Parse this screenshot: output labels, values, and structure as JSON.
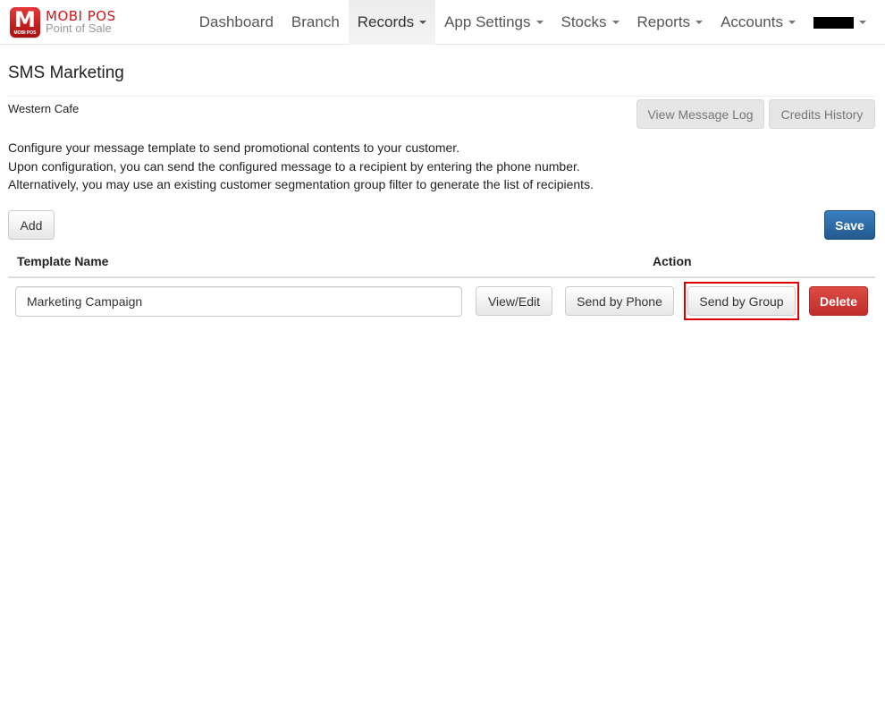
{
  "brand": {
    "logo_letter": "M",
    "logo_caption": "MOBI POS",
    "title": "MOBI POS",
    "subtitle": "Point of Sale"
  },
  "nav": {
    "items": [
      {
        "label": "Dashboard",
        "dropdown": false,
        "active": false
      },
      {
        "label": "Branch",
        "dropdown": false,
        "active": false
      },
      {
        "label": "Records",
        "dropdown": true,
        "active": true
      },
      {
        "label": "App Settings",
        "dropdown": true,
        "active": false
      },
      {
        "label": "Stocks",
        "dropdown": true,
        "active": false
      },
      {
        "label": "Reports",
        "dropdown": true,
        "active": false
      },
      {
        "label": "Accounts",
        "dropdown": true,
        "active": false
      }
    ],
    "user_menu": {
      "label": "[redacted]",
      "dropdown": true
    }
  },
  "page": {
    "title": "SMS Marketing",
    "branch": "Western Cafe",
    "buttons": {
      "view_message_log": "View Message Log",
      "credits_history": "Credits History",
      "add": "Add",
      "save": "Save"
    },
    "description": [
      "Configure your message template to send promotional contents to your customer.",
      "Upon configuration, you can send the configured message to a recipient by entering the phone number.",
      "Alternatively, you may use an existing customer segmentation group filter to generate the list of recipients."
    ]
  },
  "table": {
    "headers": {
      "template_name": "Template Name",
      "action": "Action"
    },
    "rows": [
      {
        "template_name": "Marketing Campaign",
        "actions": {
          "view_edit": "View/Edit",
          "send_by_phone": "Send by Phone",
          "send_by_group": "Send by Group",
          "delete": "Delete"
        }
      }
    ]
  },
  "colors": {
    "brand_red": "#d0161b",
    "primary_blue": "#2a6aa8",
    "danger_red": "#d43f3a",
    "highlight_red": "#e00000"
  }
}
